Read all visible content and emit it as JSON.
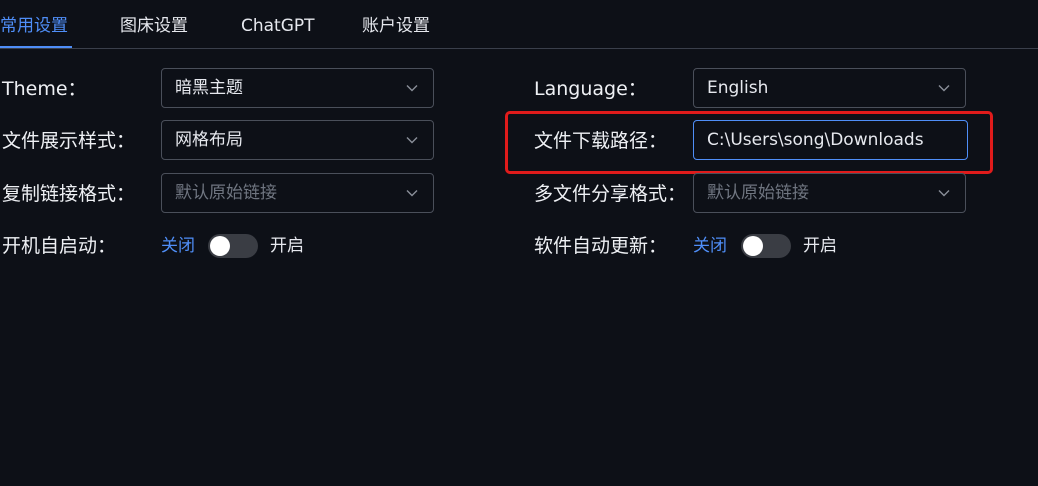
{
  "tabs": [
    {
      "label": "常用设置",
      "active": true
    },
    {
      "label": "图床设置",
      "active": false
    },
    {
      "label": "ChatGPT",
      "active": false
    },
    {
      "label": "账户设置",
      "active": false
    }
  ],
  "settings": {
    "theme": {
      "label": "Theme：",
      "value": "暗黑主题"
    },
    "language": {
      "label": "Language：",
      "value": "English"
    },
    "file_display": {
      "label": "文件展示样式：",
      "value": "网格布局"
    },
    "download_path": {
      "label": "文件下载路径：",
      "value": "C:\\Users\\song\\Downloads"
    },
    "copy_link_format": {
      "label": "复制链接格式：",
      "placeholder": "默认原始链接"
    },
    "multi_share_format": {
      "label": "多文件分享格式：",
      "placeholder": "默认原始链接"
    },
    "autostart": {
      "label": "开机自启动：",
      "off_text": "关闭",
      "on_text": "开启",
      "enabled": false
    },
    "auto_update": {
      "label": "软件自动更新：",
      "off_text": "关闭",
      "on_text": "开启",
      "enabled": false
    }
  },
  "colors": {
    "background": "#0d1017",
    "accent": "#4f8ef7",
    "highlight": "#e01b1b"
  }
}
